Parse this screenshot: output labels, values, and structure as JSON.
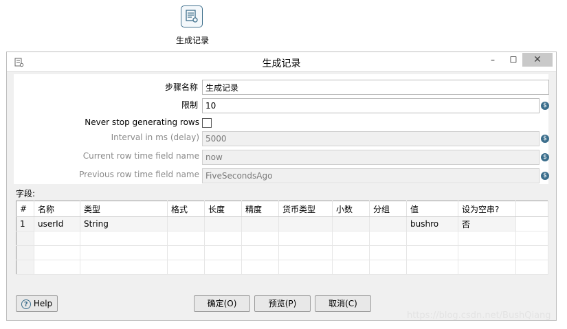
{
  "canvas": {
    "step_label": "生成记录"
  },
  "dialog": {
    "title": "生成记录",
    "window_controls": {
      "minimize": "–",
      "maximize": "☐",
      "close": "✕"
    },
    "form": {
      "step_name_label": "步骤名称",
      "step_name_value": "生成记录",
      "limit_label": "限制",
      "limit_value": "10",
      "never_stop_label": "Never stop generating rows",
      "never_stop_checked": false,
      "interval_label": "Interval in ms (delay)",
      "interval_value": "5000",
      "current_row_label": "Current row time field name",
      "current_row_value": "now",
      "previous_row_label": "Previous row time field name",
      "previous_row_value": "FiveSecondsAgo"
    },
    "fields_label": "字段:",
    "table": {
      "columns": [
        "#",
        "名称",
        "类型",
        "格式",
        "长度",
        "精度",
        "货币类型",
        "小数",
        "分组",
        "值",
        "设为空串?"
      ],
      "rows": [
        [
          "1",
          "userId",
          "String",
          "",
          "",
          "",
          "",
          "",
          "",
          "bushro",
          "否"
        ]
      ]
    },
    "buttons": {
      "help": "Help",
      "ok": "确定(O)",
      "preview": "预览(P)",
      "cancel": "取消(C)"
    }
  },
  "watermark": "https://blog.csdn.net/BushQiang",
  "colors": {
    "accent": "#3b6e8c",
    "dialog_bg": "#f0f0f0",
    "close_button": "#c9c9c9"
  }
}
